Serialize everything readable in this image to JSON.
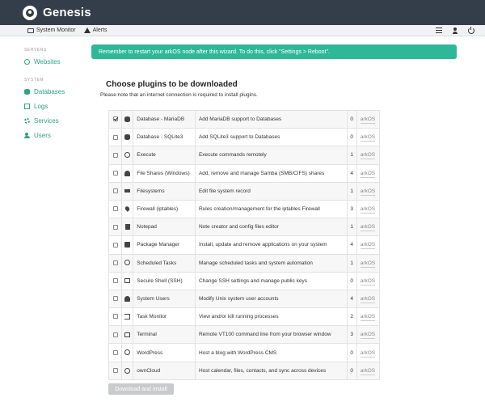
{
  "app": {
    "title": "Genesis"
  },
  "menubar": {
    "system_monitor": "System Monitor",
    "alerts": "Alerts"
  },
  "sidebar": {
    "sections": [
      {
        "title": "SERVERS",
        "items": [
          {
            "label": "Websites",
            "icon": "globe-icon"
          }
        ]
      },
      {
        "title": "SYSTEM",
        "items": [
          {
            "label": "Databases",
            "icon": "database-icon"
          },
          {
            "label": "Logs",
            "icon": "logs-icon"
          },
          {
            "label": "Services",
            "icon": "gear-icon"
          },
          {
            "label": "Users",
            "icon": "users-icon"
          }
        ]
      }
    ]
  },
  "banner": {
    "text": "Remember to restart your arkOS node after this wizard. To do this, click \"Settings > Reboot\"."
  },
  "main": {
    "heading": "Choose plugins to be downloaded",
    "note": "Please note that an internet connection is required to install plugins.",
    "install_button": "Download and install"
  },
  "plugins": [
    {
      "checked": true,
      "icon": "database-icon",
      "name": "Database - MariaDB",
      "description": "Add MariaDB support to Databases",
      "count": "0",
      "author": "arkOS"
    },
    {
      "checked": false,
      "icon": "database-icon",
      "name": "Database - SQLite3",
      "description": "Add SQLite3 support to Databases",
      "count": "0",
      "author": "arkOS"
    },
    {
      "checked": false,
      "icon": "cog-icon",
      "name": "Execute",
      "description": "Execute commands remotely",
      "count": "1",
      "author": "arkOS"
    },
    {
      "checked": false,
      "icon": "share-icon",
      "name": "File Shares (Windows)",
      "description": "Add, remove and manage Samba (SMB/CIFS) shares",
      "count": "4",
      "author": "arkOS"
    },
    {
      "checked": false,
      "icon": "hdd-icon",
      "name": "Filesystems",
      "description": "Edit file system record",
      "count": "1",
      "author": "arkOS"
    },
    {
      "checked": false,
      "icon": "fire-icon",
      "name": "Firewall (iptables)",
      "description": "Rules creation/management for the iptables Firewall",
      "count": "3",
      "author": "arkOS"
    },
    {
      "checked": false,
      "icon": "file-icon",
      "name": "Notepad",
      "description": "Note creator and config files editor",
      "count": "1",
      "author": "arkOS"
    },
    {
      "checked": false,
      "icon": "package-icon",
      "name": "Package Manager",
      "description": "Install, update and remove applications on your system",
      "count": "4",
      "author": "arkOS"
    },
    {
      "checked": false,
      "icon": "clock-icon",
      "name": "Scheduled Tasks",
      "description": "Manage scheduled tasks and system automation",
      "count": "1",
      "author": "arkOS"
    },
    {
      "checked": false,
      "icon": "terminal-icon",
      "name": "Secure Shell (SSH)",
      "description": "Change SSH settings and manage public keys",
      "count": "0",
      "author": "arkOS"
    },
    {
      "checked": false,
      "icon": "user-icon",
      "name": "System Users",
      "description": "Modify Unix system user accounts",
      "count": "4",
      "author": "arkOS"
    },
    {
      "checked": false,
      "icon": "signin-icon",
      "name": "Task Monitor",
      "description": "View and/or kill running processes",
      "count": "2",
      "author": "arkOS"
    },
    {
      "checked": false,
      "icon": "terminal-icon",
      "name": "Terminal",
      "description": "Remote VT100 command line from your browser window",
      "count": "3",
      "author": "arkOS"
    },
    {
      "checked": false,
      "icon": "globe-icon",
      "name": "WordPress",
      "description": "Host a blog with WordPress CMS",
      "count": "0",
      "author": "arkOS"
    },
    {
      "checked": false,
      "icon": "globe-icon",
      "name": "ownCloud",
      "description": "Host calendar, files, contacts, and sync across devices",
      "count": "0",
      "author": "arkOS"
    }
  ],
  "colors": {
    "accent": "#2fb898",
    "titlebar": "#343e4a",
    "link": "#2ea383"
  }
}
